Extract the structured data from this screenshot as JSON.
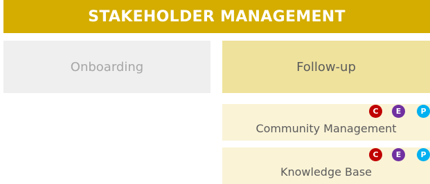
{
  "title": "STAKEHOLDER MANAGEMENT",
  "columns": [
    {
      "label": "Onboarding"
    },
    {
      "label": "Follow-up"
    }
  ],
  "subitems": [
    {
      "label": "Community Management",
      "badges": [
        {
          "letter": "C",
          "color": "#c00000"
        },
        {
          "letter": "E",
          "color": "#7030a0"
        },
        {
          "letter": "P",
          "color": "#00b0f0"
        }
      ]
    },
    {
      "label": "Knowledge Base",
      "badges": [
        {
          "letter": "C",
          "color": "#c00000"
        },
        {
          "letter": "E",
          "color": "#7030a0"
        },
        {
          "letter": "P",
          "color": "#00b0f0"
        }
      ]
    }
  ],
  "colors": {
    "banner": "#d4ad00",
    "onboarding_bg": "#efefef",
    "followup_bg": "#efe29c",
    "subitem_bg": "#faf3d6"
  }
}
